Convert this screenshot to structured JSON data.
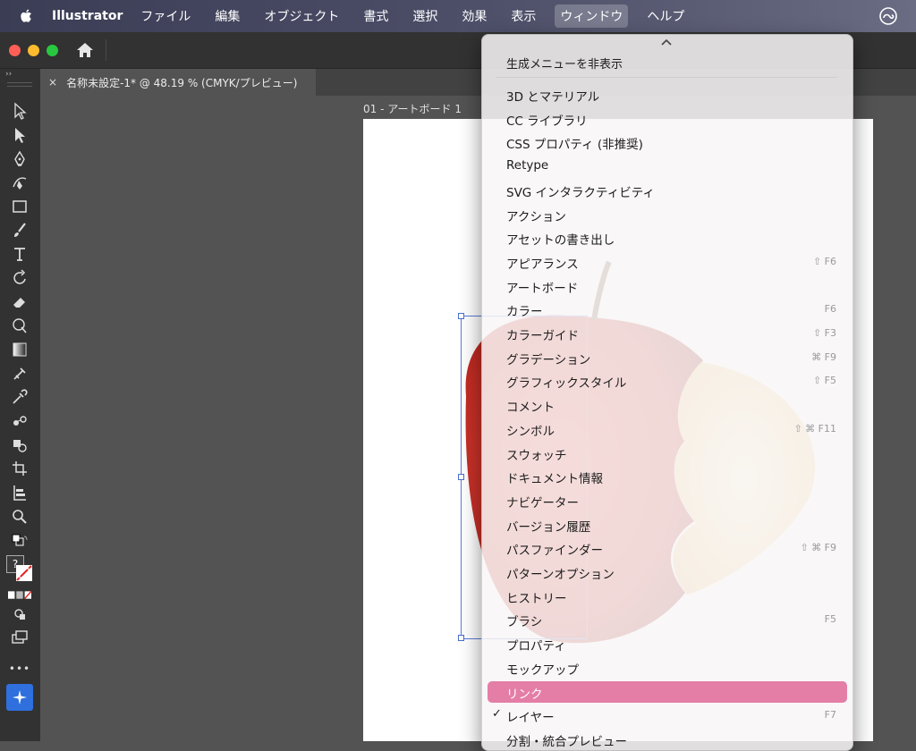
{
  "menubar": {
    "app_name": "Illustrator",
    "items": [
      "ファイル",
      "編集",
      "オブジェクト",
      "書式",
      "選択",
      "効果",
      "表示",
      "ウィンドウ",
      "ヘルプ"
    ],
    "active_item": "ウィンドウ"
  },
  "document": {
    "tab_title": "名称未設定-1* @ 48.19 % (CMYK/プレビュー)",
    "close_glyph": "×",
    "artboard_label": "01 - アートボード 1"
  },
  "toolbar": {
    "collapse_glyph": "››",
    "more_glyph": "•••",
    "unknown_fill_glyph": "?"
  },
  "window_menu": {
    "top_item": "生成メニューを非表示",
    "items": [
      {
        "label": "3D とマテリアル",
        "shortcut": ""
      },
      {
        "label": "CC ライブラリ",
        "shortcut": ""
      },
      {
        "label": "CSS プロパティ (非推奨)",
        "shortcut": ""
      },
      {
        "label": "Retype",
        "shortcut": ""
      },
      {
        "label": "SVG インタラクティビティ",
        "shortcut": ""
      },
      {
        "label": "アクション",
        "shortcut": ""
      },
      {
        "label": "アセットの書き出し",
        "shortcut": ""
      },
      {
        "label": "アピアランス",
        "shortcut": "⇧ F6"
      },
      {
        "label": "アートボード",
        "shortcut": ""
      },
      {
        "label": "カラー",
        "shortcut": "F6"
      },
      {
        "label": "カラーガイド",
        "shortcut": "⇧ F3"
      },
      {
        "label": "グラデーション",
        "shortcut": "⌘ F9"
      },
      {
        "label": "グラフィックスタイル",
        "shortcut": "⇧ F5"
      },
      {
        "label": "コメント",
        "shortcut": ""
      },
      {
        "label": "シンボル",
        "shortcut": "⇧ ⌘ F11"
      },
      {
        "label": "スウォッチ",
        "shortcut": ""
      },
      {
        "label": "ドキュメント情報",
        "shortcut": ""
      },
      {
        "label": "ナビゲーター",
        "shortcut": ""
      },
      {
        "label": "バージョン履歴",
        "shortcut": ""
      },
      {
        "label": "パスファインダー",
        "shortcut": "⇧ ⌘ F9"
      },
      {
        "label": "パターンオプション",
        "shortcut": ""
      },
      {
        "label": "ヒストリー",
        "shortcut": ""
      },
      {
        "label": "ブラシ",
        "shortcut": "F5"
      },
      {
        "label": "プロパティ",
        "shortcut": ""
      },
      {
        "label": "モックアップ",
        "shortcut": ""
      },
      {
        "label": "リンク",
        "shortcut": "",
        "highlighted": true
      },
      {
        "label": "レイヤー",
        "shortcut": "F7",
        "checked": true
      },
      {
        "label": "分割・統合プレビュー",
        "shortcut": ""
      }
    ],
    "check_glyph": "✓",
    "highlight_color": "#e47ea7"
  },
  "colors": {
    "close": "#ff5f57",
    "minimize": "#febc2e",
    "zoom": "#28c840",
    "selection": "#5b7bd6"
  }
}
